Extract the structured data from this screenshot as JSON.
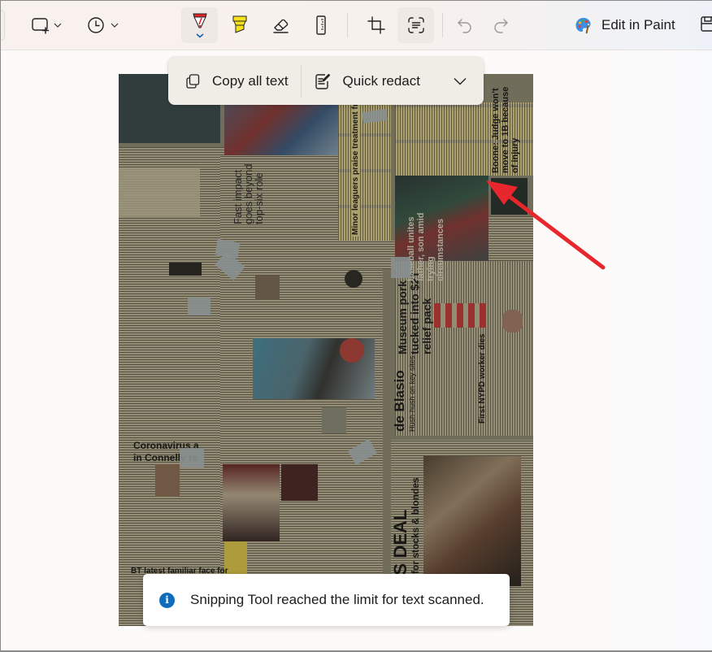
{
  "toolbar": {
    "snip_mode_icon": "rectangle-snip-icon",
    "delay_icon": "clock-icon",
    "tools": [
      {
        "name": "ballpoint-pen",
        "icon": "pen-icon",
        "color": "#e0262b",
        "active": true
      },
      {
        "name": "highlighter",
        "icon": "highlighter-icon",
        "color": "#f5e11c"
      },
      {
        "name": "eraser",
        "icon": "eraser-icon"
      },
      {
        "name": "ruler",
        "icon": "ruler-icon"
      },
      {
        "name": "crop",
        "icon": "crop-icon"
      },
      {
        "name": "text-actions",
        "icon": "text-actions-icon",
        "active": true
      },
      {
        "name": "undo",
        "icon": "undo-icon",
        "disabled": true
      },
      {
        "name": "redo",
        "icon": "redo-icon",
        "disabled": true
      }
    ],
    "edit_in_paint_label": "Edit in Paint",
    "save_icon": "save-icon"
  },
  "text_actions": {
    "copy_all_label": "Copy all text",
    "quick_redact_label": "Quick redact"
  },
  "snip": {
    "description": "Photo of a wall covered in taped newspaper clippings",
    "headlines": [
      "Minor leaguers praise treatment from Yankees",
      "Boone: Judge won't move to 1B because of injury",
      "Fast impact goes beyond top-six role",
      "Museum pork tucked into $2T relief pack",
      "de Blasio",
      "Hush-hush on key sites",
      "First NYPD worker dies",
      "Coronavirus a",
      "in Connelly re",
      "BT latest familiar face for",
      "baseball unites father, son amid trying circumstances",
      "for stocks & blondes",
      "MULUS DEAL"
    ]
  },
  "annotation": {
    "type": "arrow",
    "color": "#e8262d"
  },
  "toast": {
    "icon": "info-icon",
    "message": "Snipping Tool reached the limit for text scanned."
  }
}
